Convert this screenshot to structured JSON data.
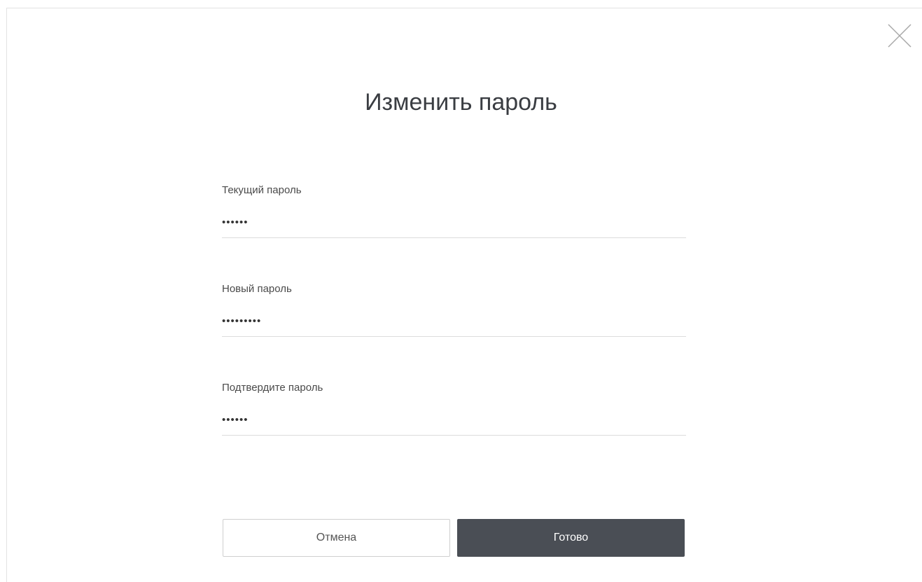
{
  "dialog": {
    "title": "Изменить пароль",
    "close_icon": "close-icon"
  },
  "fields": [
    {
      "label": "Текущий пароль",
      "value": "••••••"
    },
    {
      "label": "Новый пароль",
      "value": "•••••••••"
    },
    {
      "label": "Подтвердите пароль",
      "value": "••••••"
    }
  ],
  "buttons": {
    "cancel_label": "Отмена",
    "done_label": "Готово"
  },
  "colors": {
    "primary_button": "#4a4e55",
    "divider": "#dcdcdc"
  }
}
